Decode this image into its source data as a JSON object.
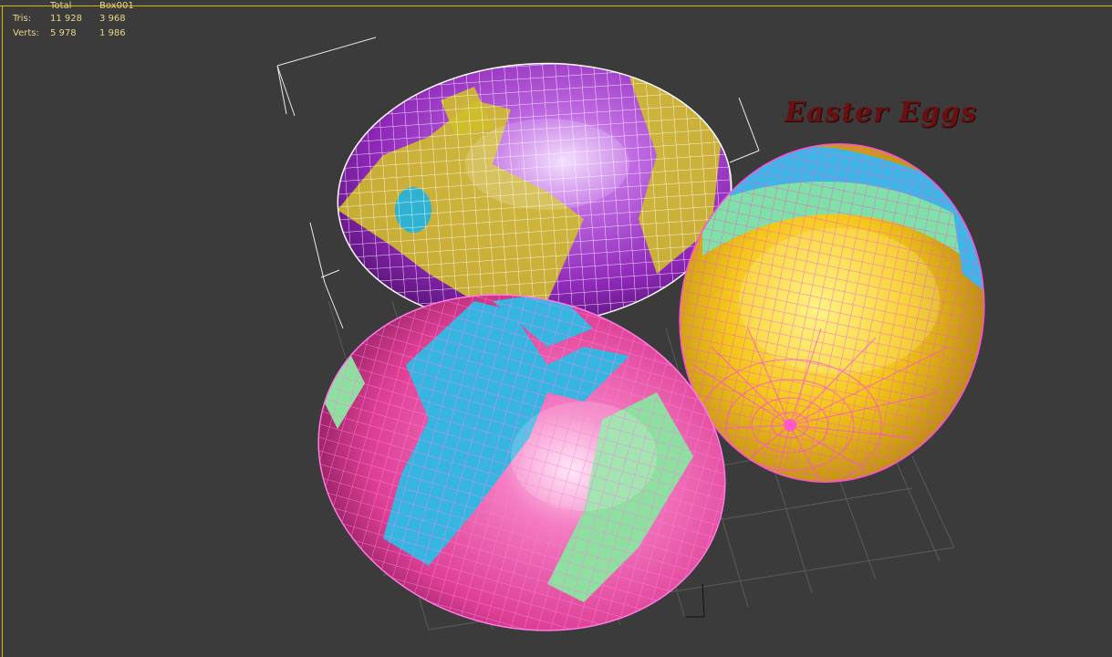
{
  "stats": {
    "header_total": "Total",
    "header_object": "Box001",
    "rows": [
      {
        "label": "Tris:",
        "total": "11 928",
        "object": "3 968"
      },
      {
        "label": "Verts:",
        "total": "5 978",
        "object": "1 986"
      }
    ]
  },
  "scene": {
    "title": "Easter Eggs",
    "background_color": "#3b3b3b",
    "frame_color": "#d9b600",
    "grid_color": "#5a5a5a",
    "eggs": [
      {
        "name": "purple-yellow-egg",
        "base_color": "#9b2fc4",
        "stripe_color": "#d6c21f",
        "spot_color": "#2ab0d0",
        "wire_color": "#ffffff"
      },
      {
        "name": "yellow-striped-egg",
        "base_color": "#f2c417",
        "stripe_colors": [
          "#3eb6e6",
          "#7fe0a8"
        ],
        "wire_color": "#ff55d8"
      },
      {
        "name": "pink-blue-egg",
        "base_color": "#f05aa8",
        "stripe_colors": [
          "#35b6e0",
          "#8ee0a0"
        ],
        "wire_color": "#ff6be0"
      }
    ]
  }
}
